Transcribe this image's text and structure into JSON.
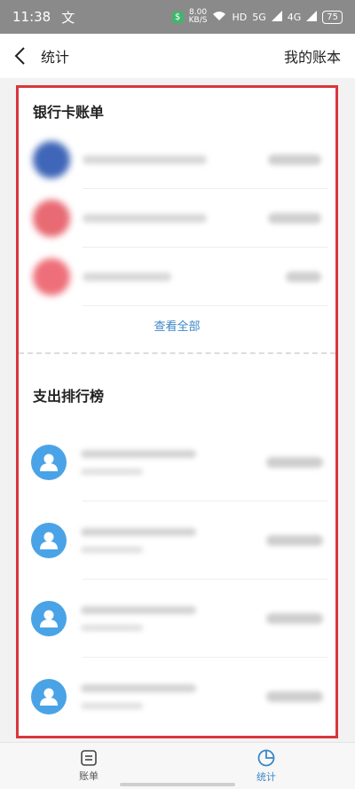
{
  "status_bar": {
    "time": "11:38",
    "notif_glyph": "文",
    "speed_value": "8.00",
    "speed_unit": "KB/S",
    "network_hd": "HD",
    "signal_5g": "5G",
    "signal_4g": "4G",
    "battery": "75"
  },
  "header": {
    "title": "统计",
    "right_link": "我的账本"
  },
  "bank_section": {
    "title": "银行卡账单",
    "view_all": "查看全部",
    "items": [
      {
        "avatar_color": "#3f66b8"
      },
      {
        "avatar_color": "#e86a73"
      },
      {
        "avatar_color": "#ee6f79"
      }
    ]
  },
  "rank_section": {
    "title": "支出排行榜",
    "items": [
      {},
      {},
      {},
      {}
    ]
  },
  "tabbar": {
    "tabs": [
      {
        "label": "账单",
        "icon": "bill-icon",
        "active": false
      },
      {
        "label": "统计",
        "icon": "pie-chart-icon",
        "active": true
      }
    ]
  },
  "colors": {
    "accent": "#3b86c6",
    "highlight_border": "#d9363e",
    "person_avatar": "#4aa3e6"
  }
}
